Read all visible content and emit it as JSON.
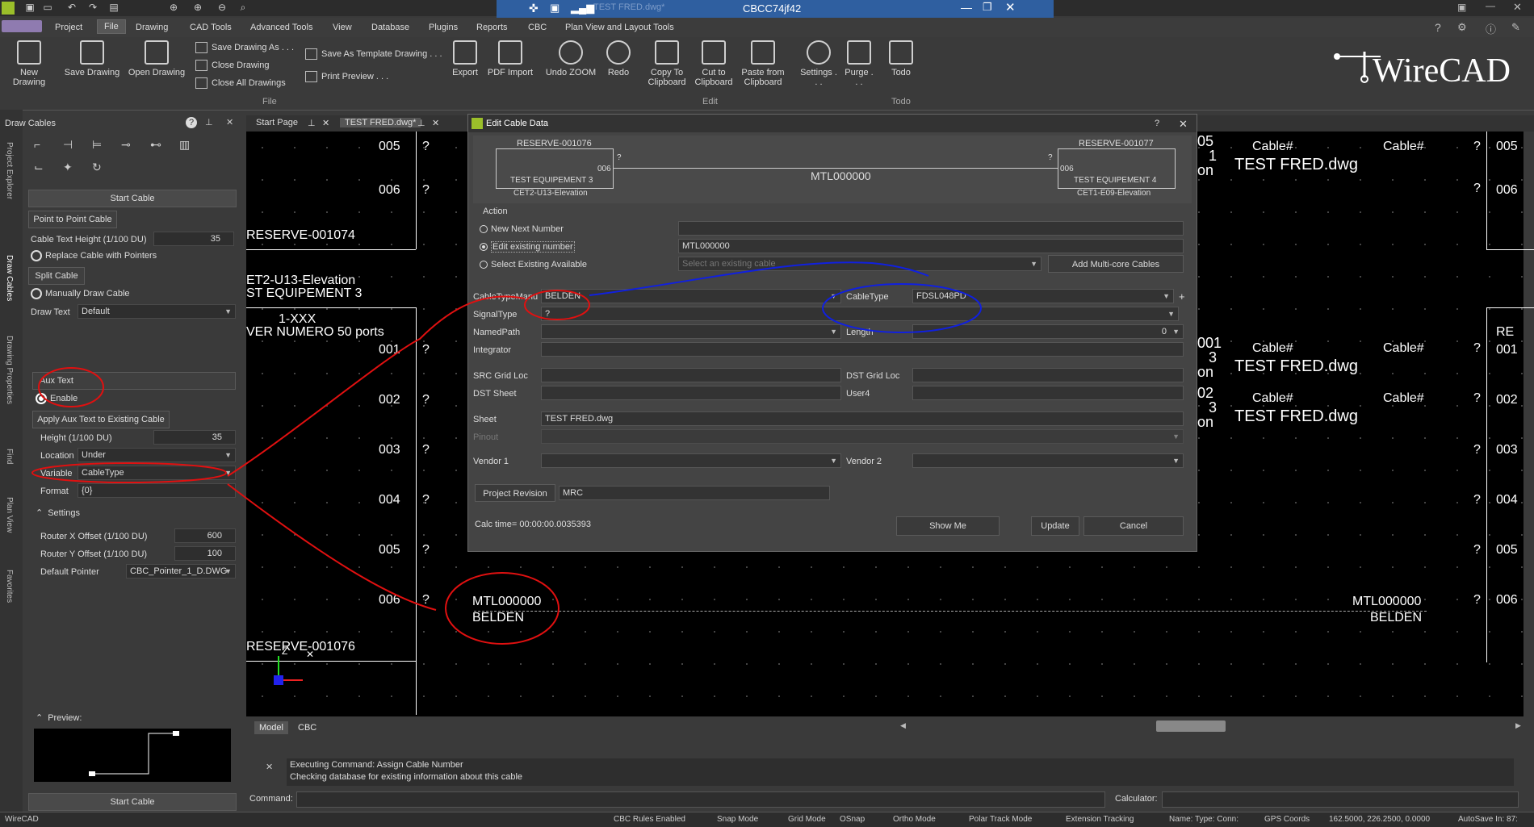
{
  "title_bar": {
    "document_name": "CBCC74jf42",
    "faded_text": "TEST FRED.dwg*"
  },
  "menu": [
    "Project",
    "File",
    "Drawing",
    "CAD Tools",
    "Advanced Tools",
    "View",
    "Database",
    "Plugins",
    "Reports",
    "CBC",
    "Plan View and Layout Tools"
  ],
  "ribbon": {
    "new_drawing": "New Drawing",
    "save_drawing": "Save Drawing",
    "open_drawing": "Open Drawing",
    "save_drawing_as": "Save Drawing As . . .",
    "close_drawing": "Close Drawing",
    "close_all": "Close All Drawings",
    "save_template": "Save As Template Drawing . . .",
    "print_preview": "Print Preview . . .",
    "export": "Export",
    "pdf_import": "PDF Import",
    "undo": "Undo ZOOM",
    "redo": "Redo",
    "copy": "Copy To Clipboard",
    "cut": "Cut to Clipboard",
    "paste": "Paste from Clipboard",
    "settings": "Settings . . .",
    "purge": "Purge . . .",
    "todo": "Todo",
    "group_file": "File",
    "group_edit": "Edit",
    "group_todo": "Todo",
    "logo": "WireCAD"
  },
  "side_tabs": [
    "Project Explorer",
    "Draw Cables",
    "Drawing Properties",
    "Find",
    "Plan View",
    "Favorites"
  ],
  "left_panel": {
    "title": "Draw Cables",
    "start_cable": "Start Cable",
    "point_to_point": "Point to Point Cable",
    "cable_text_height_label": "Cable Text Height (1/100 DU)",
    "cable_text_height": "35",
    "replace_cable": "Replace Cable with Pointers",
    "split_cable": "Split Cable",
    "manual_draw": "Manually Draw Cable",
    "draw_text_label": "Draw Text",
    "draw_text": "Default",
    "aux_text": "Aux Text",
    "enable": "Enable",
    "apply_aux": "Apply Aux Text to Existing Cable",
    "height_label": "Height (1/100 DU)",
    "height": "35",
    "location_label": "Location",
    "location": "Under",
    "variable_label": "Variable",
    "variable": "CableType",
    "format_label": "Format",
    "format": "{0}",
    "settings": "Settings",
    "router_x_label": "Router X Offset (1/100 DU)",
    "router_x": "600",
    "router_y_label": "Router Y Offset (1/100 DU)",
    "router_y": "100",
    "default_pointer_label": "Default Pointer",
    "default_pointer": "CBC_Pointer_1_D.DWG",
    "preview": "Preview:",
    "start_cable_bottom": "Start Cable"
  },
  "doc_tabs": [
    "Start Page",
    "TEST FRED.dwg*"
  ],
  "canvas": {
    "left_rows": [
      "005",
      "006",
      "001",
      "002",
      "003",
      "004",
      "005",
      "006"
    ],
    "reserve_top": "RESERVE-001074",
    "elevation": "ET2-U13-Elevation",
    "equip": "ST EQUIPEMENT 3",
    "xxx": "1-XXX",
    "server": "VER NUMERO 50 ports",
    "reserve_bottom": "RESERVE-001076",
    "cable_num": "MTL000000",
    "cable_type": "BELDEN",
    "q": "?",
    "right_cable": "Cable#",
    "right_file": "TEST FRED.dwg",
    "right_rows": [
      "005",
      "006",
      "001",
      "002",
      "003",
      "004",
      "005",
      "006"
    ],
    "right_partial": [
      "05",
      "1",
      "on",
      "001",
      "3",
      "on",
      "02",
      "3",
      "on"
    ],
    "re": "RE"
  },
  "dialog": {
    "title": "Edit Cable Data",
    "src_reserve": "RESERVE-001076",
    "dst_reserve": "RESERVE-001077",
    "src_equip": "TEST EQUIPEMENT 3",
    "dst_equip": "TEST EQUIPEMENT 4",
    "src_elev": "CET2-U13-Elevation",
    "dst_elev": "CET1-E09-Elevation",
    "port": "006",
    "cable": "MTL000000",
    "q": "?",
    "action": "Action",
    "new_next": "New Next Number",
    "edit_existing": "Edit existing number",
    "edit_value": "MTL000000",
    "select_existing": "Select Existing Available",
    "select_placeholder": "Select an existing cable",
    "add_multicore": "Add Multi-core Cables",
    "manu_label": "CableTypeManu",
    "manu": "BELDEN",
    "cabletype_label": "CableType",
    "cabletype": "FDSL048PD",
    "signal_label": "SignalType",
    "signal": "?",
    "namedpath_label": "NamedPath",
    "length_label": "Length",
    "length": "0",
    "integrator_label": "Integrator",
    "src_grid_label": "SRC Grid Loc",
    "dst_grid_label": "DST Grid Loc",
    "dst_sheet_label": "DST Sheet",
    "user4_label": "User4",
    "sheet_label": "Sheet",
    "sheet": "TEST FRED.dwg",
    "pinout_label": "Pinout",
    "vendor1_label": "Vendor 1",
    "vendor2_label": "Vendor 2",
    "project_revision": "Project Revision",
    "revision": "MRC",
    "calc_time": "Calc time= 00:00:00.0035393",
    "show_me": "Show Me",
    "update": "Update",
    "cancel": "Cancel"
  },
  "bottom_tabs": [
    "Model",
    "CBC"
  ],
  "command": {
    "line1": "Executing Command: Assign Cable Number",
    "line2": "Checking database for existing information about this cable",
    "command_label": "Command:",
    "calculator_label": "Calculator:"
  },
  "status": [
    "WireCAD",
    "CBC Rules Enabled",
    "Snap Mode",
    "Grid Mode",
    "OSnap",
    "Ortho Mode",
    "Polar Track Mode",
    "Extension Tracking",
    "Name: Type: Conn:",
    "GPS Coords",
    "162.5000, 226.2500, 0.0000",
    "AutoSave In: 87:"
  ]
}
